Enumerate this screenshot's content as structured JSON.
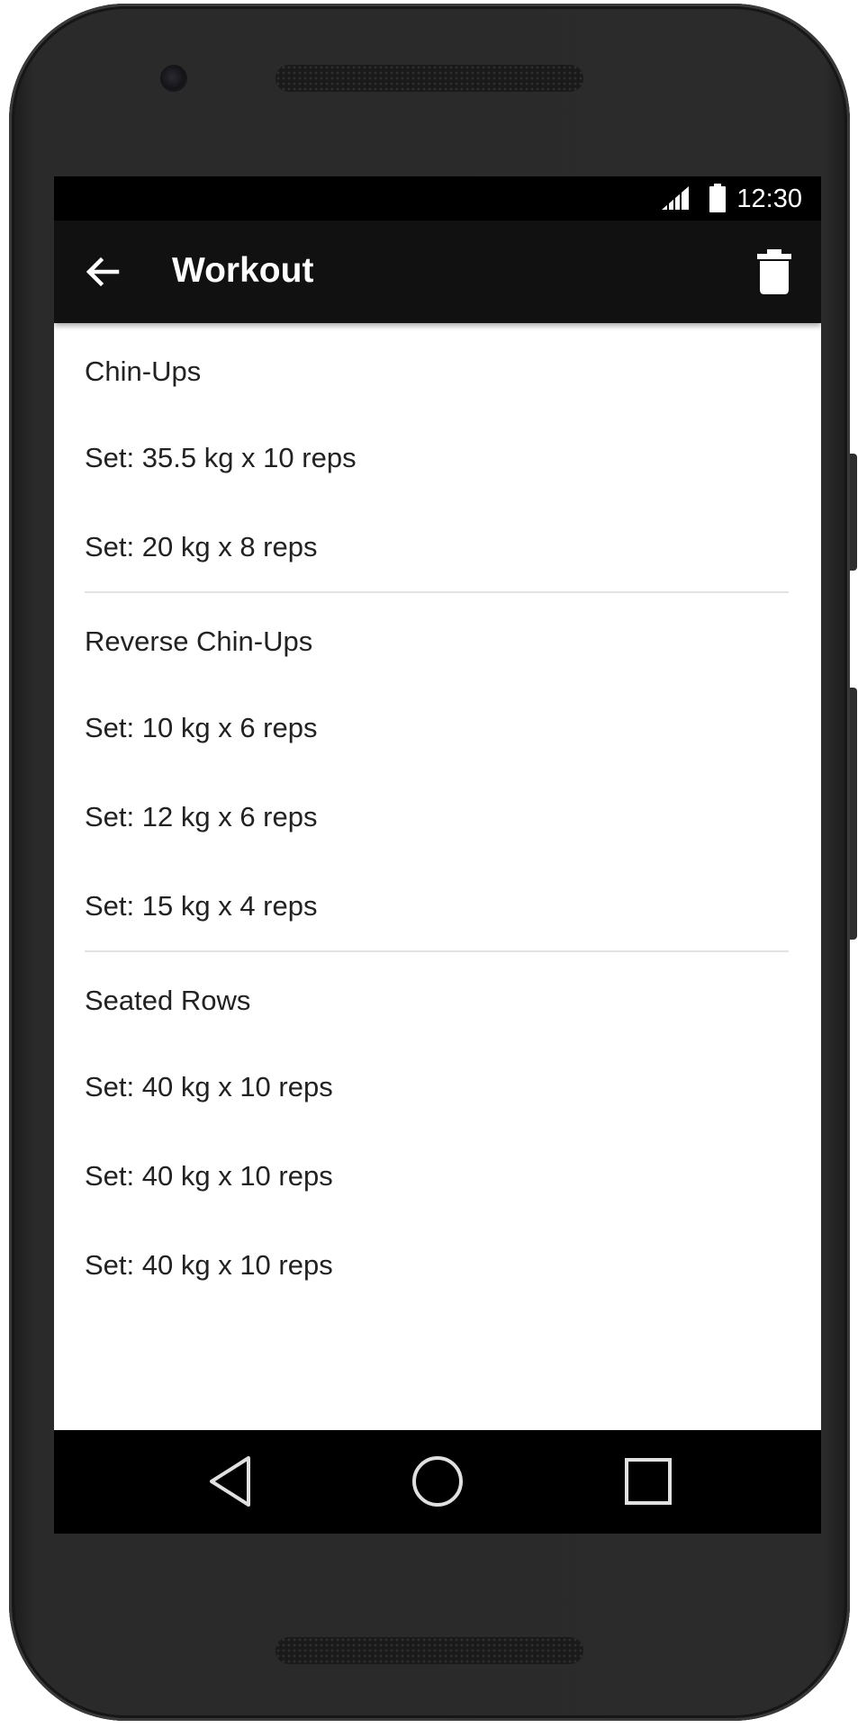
{
  "status_bar": {
    "time": "12:30",
    "icons": [
      "signal-icon",
      "battery-icon"
    ]
  },
  "toolbar": {
    "back_icon": "arrow-back-icon",
    "title": "Workout",
    "delete_icon": "trash-icon"
  },
  "exercises": [
    {
      "name": "Chin-Ups",
      "sets": [
        "Set: 35.5 kg x 10 reps",
        "Set: 20 kg x 8 reps"
      ]
    },
    {
      "name": "Reverse Chin-Ups",
      "sets": [
        "Set: 10 kg x 6 reps",
        "Set: 12 kg x 6 reps",
        "Set: 15 kg x 4 reps"
      ]
    },
    {
      "name": "Seated Rows",
      "sets": [
        "Set: 40 kg x 10 reps",
        "Set: 40 kg x 10 reps",
        "Set: 40 kg x 10 reps"
      ]
    }
  ],
  "nav_bar": {
    "icons": [
      "nav-back-icon",
      "nav-home-icon",
      "nav-recents-icon"
    ]
  },
  "colors": {
    "status_bar": "#000000",
    "toolbar": "#111111",
    "nav_bar": "#000000",
    "divider": "#e2e2e2",
    "text": "#222222"
  }
}
